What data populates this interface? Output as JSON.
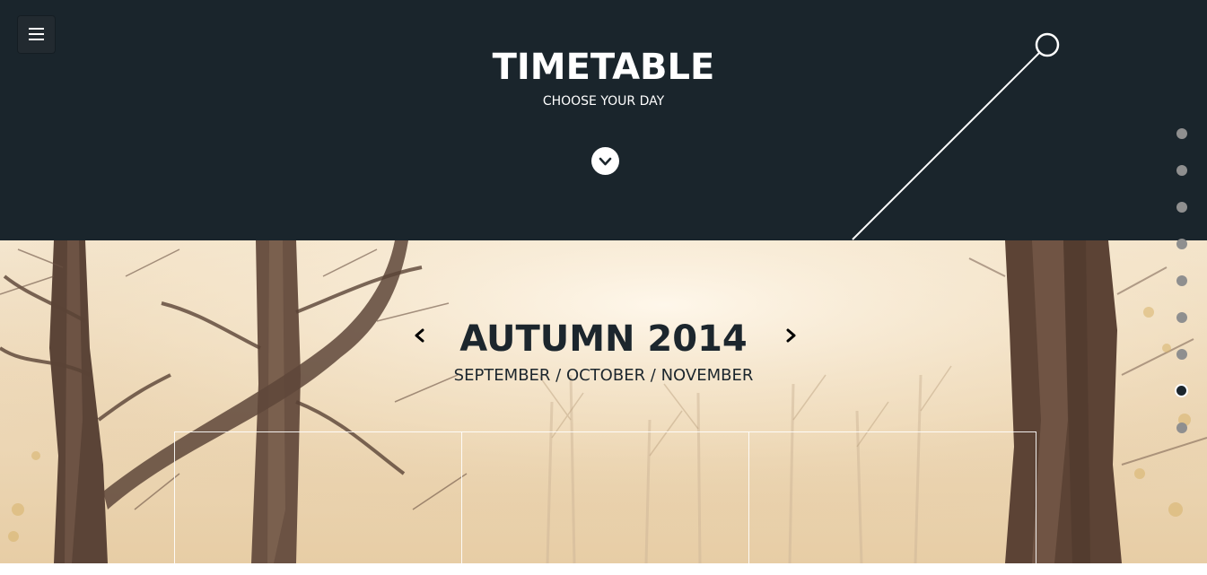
{
  "header": {
    "title": "TIMETABLE",
    "subtitle": "CHOOSE YOUR DAY",
    "menu_icon": "hamburger-icon",
    "scroll_icon": "chevron-down-icon",
    "background_color": "#1a252c"
  },
  "season": {
    "title": "AUTUMN 2014",
    "months": "SEPTEMBER / OCTOBER / NOVEMBER",
    "prev_icon": "chevron-left-icon",
    "next_icon": "chevron-right-icon",
    "text_color": "#1c262d"
  },
  "timetable": {
    "columns": [
      "",
      "",
      ""
    ]
  },
  "side_nav": {
    "dots": [
      {
        "active": false
      },
      {
        "active": false
      },
      {
        "active": false
      },
      {
        "active": false
      },
      {
        "active": false
      },
      {
        "active": false
      },
      {
        "active": false
      },
      {
        "active": true
      },
      {
        "active": false
      }
    ],
    "dot_color": "#8f8f8f",
    "active_color": "#1c262d"
  }
}
